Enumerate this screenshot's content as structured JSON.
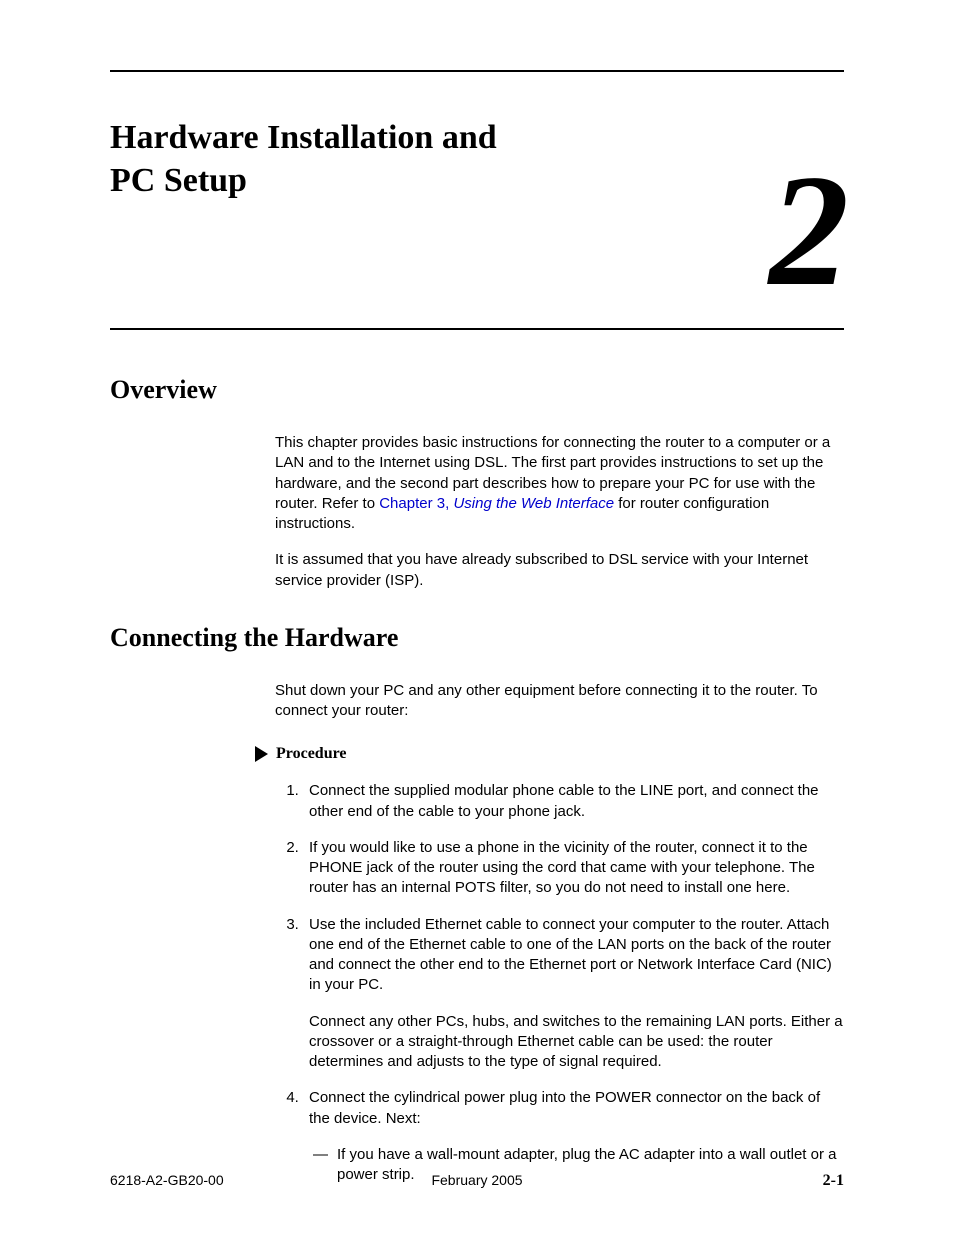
{
  "chapter": {
    "title": "Hardware Installation and PC Setup",
    "number": "2"
  },
  "sections": {
    "overview": {
      "heading": "Overview",
      "para1_pre": "This chapter provides basic instructions for connecting the router to a computer or a LAN and to the Internet using DSL. The first part provides instructions to set up the hardware, and the second part describes how to prepare your PC for use with the router. Refer to ",
      "link_chapter": "Chapter 3, ",
      "link_title": "Using the Web Interface",
      "para1_post": " for router configuration instructions.",
      "para2": "It is assumed that you have already subscribed to DSL service with your Internet service provider (ISP)."
    },
    "connecting": {
      "heading": "Connecting the Hardware",
      "intro": "Shut down your PC and any other equipment before connecting it to the router. To connect your router:",
      "procedure_label": "Procedure",
      "steps": {
        "s1": "Connect the supplied modular phone cable to the LINE port, and connect the other end of the cable to your phone jack.",
        "s2": "If you would like to use a phone in the vicinity of the router, connect it to the PHONE jack of the router using the cord that came with your telephone. The router has an internal POTS filter, so you do not need to install one here.",
        "s3": "Use the included Ethernet cable to connect your computer to the router. Attach one end of the Ethernet cable to one of the LAN ports on the back of the router and connect the other end to the Ethernet port or Network Interface Card (NIC) in your PC.",
        "s3b": "Connect any other PCs, hubs, and switches to the remaining LAN ports. Either a crossover or a straight-through Ethernet cable can be used: the router determines and adjusts to the type of signal required.",
        "s4": "Connect the cylindrical power plug into the POWER connector on the back of the device. Next:",
        "s4_dash1": "If you have a wall-mount adapter, plug the AC adapter into a wall outlet or a power strip."
      }
    }
  },
  "footer": {
    "left": "6218-A2-GB20-00",
    "center": "February 2005",
    "right": "2-1"
  }
}
